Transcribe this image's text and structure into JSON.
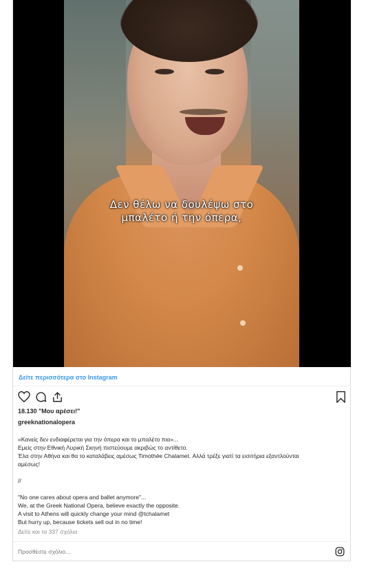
{
  "video": {
    "subtitle_line1": "Δεν θέλω να δουλέψω στο",
    "subtitle_line2": "μπαλέτο ή την όπερα,"
  },
  "view_more_label": "Δείτε περισσότερα στο Instagram",
  "actions": {
    "like_icon": "heart-icon",
    "comment_icon": "comment-icon",
    "share_icon": "share-icon",
    "save_icon": "bookmark-icon"
  },
  "likes_text": "18.130 \"Μου αρέσει!\"",
  "username": "greeknationalopera",
  "caption": {
    "lines": [
      "«Κανείς δεν ενδιαφέρεται για την όπερα και το μπαλέτο πια»...",
      "Εμείς στην Εθνική Λυρική Σκηνή πιστεύουμε ακριβώς το αντίθετο.",
      "Έλα στην Αθήνα και θα το καταλάβεις αμέσως Timothée Chalamet. Αλλά τρέξε γιατί τα εισιτήρια εξαντλούνται",
      "αμέσως!",
      "//",
      "\"No one cares about opera and ballet anymore\"...",
      "We, at the Greek National Opera, believe exactly the opposite.",
      "A visit to Athens will quickly change your mind @tchalamet",
      "But hurry up, because tickets sell out in no time!"
    ]
  },
  "comments_link": "Δείτε και τα 337 σχόλια",
  "comment_placeholder": "Προσθέστε σχόλιο...",
  "colors": {
    "link_blue": "#3897f0",
    "muted_gray": "#8e8e8e",
    "text_dark": "#262626"
  }
}
